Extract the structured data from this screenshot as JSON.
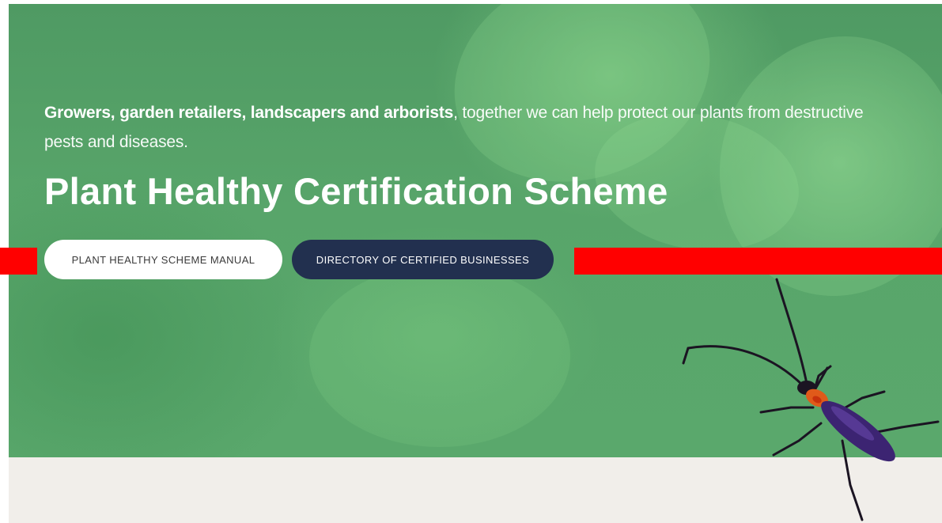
{
  "hero": {
    "intro_bold": "Growers, garden retailers, landscapers and arborists",
    "intro_rest": ", together we can help protect our plants from destructive pests and diseases.",
    "title": "Plant Healthy Certification Scheme"
  },
  "buttons": {
    "manual": "PLANT HEALTHY SCHEME MANUAL",
    "directory": "DIRECTORY OF CERTIFIED BUSINESSES"
  },
  "colors": {
    "hero_green": "#58a56a",
    "directory_button": "#22304f",
    "manual_button": "#ffffff",
    "bottom_band": "#f1eeea",
    "red_bar": "#ff0000"
  },
  "images": {
    "hero_background": "green-leaf-photo",
    "beetle": "longhorn-beetle-photo"
  }
}
